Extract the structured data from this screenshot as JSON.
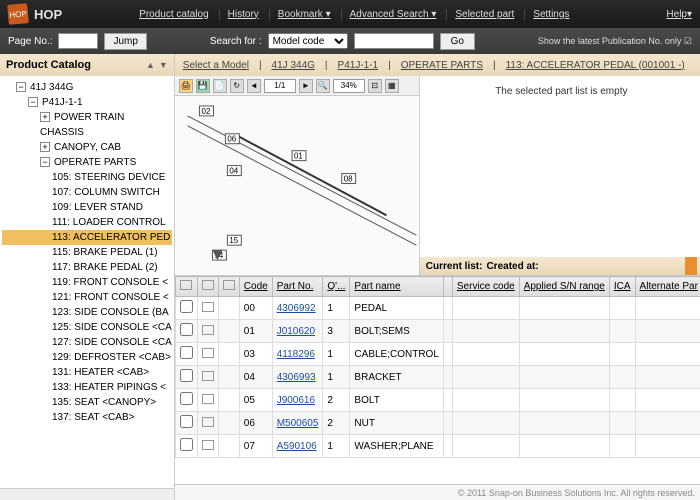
{
  "app": {
    "name": "HOP",
    "logo_text": "HOP"
  },
  "top_nav": [
    "Product catalog",
    "History",
    "Bookmark ▾",
    "Advanced Search ▾",
    "Selected part",
    "Settings"
  ],
  "help": "Help▾",
  "page_no_label": "Page No.:",
  "jump": "Jump",
  "search_for": "Search for :",
  "model_code": "Model code",
  "go": "Go",
  "pub_text": "Show the latest Publication No. only ☑",
  "sidebar_title": "Product Catalog",
  "tree": {
    "root": "41J 344G",
    "sub": "P41J-1-1",
    "groups": [
      "POWER TRAIN",
      "CHASSIS",
      "CANOPY, CAB",
      "OPERATE PARTS"
    ],
    "items": [
      "105: STEERING DEVICE",
      "107: COLUMN SWITCH",
      "109: LEVER STAND",
      "111: LOADER CONTROL",
      "113: ACCELERATOR PED",
      "115: BRAKE PEDAL (1)",
      "117: BRAKE PEDAL (2)",
      "119: FRONT CONSOLE <",
      "121: FRONT CONSOLE <",
      "123: SIDE CONSOLE (BA",
      "125: SIDE CONSOLE <CA",
      "127: SIDE CONSOLE <CA",
      "129: DEFROSTER <CAB>",
      "131: HEATER <CAB>",
      "133: HEATER PIPINGS <",
      "135: SEAT <CANOPY>",
      "137: SEAT <CAB>"
    ],
    "selected_index": 4
  },
  "breadcrumb": [
    "Select a Model",
    "41J 344G",
    "P41J-1-1",
    "OPERATE PARTS",
    "113: ACCELERATOR PEDAL (001001 -)"
  ],
  "diagram": {
    "page": "1/1",
    "zoom": "34%",
    "callouts": [
      "02",
      "06",
      "04",
      "01",
      "08",
      "15",
      "14"
    ]
  },
  "empty_msg": "The selected part list is empty",
  "current_list_label": "Current list:",
  "created_at_label": "Created at:",
  "table": {
    "headers": [
      "",
      "",
      "",
      "Code",
      "Part No.",
      "Q'...",
      "Part name",
      "",
      "Service code",
      "Applied S/N range",
      "ICA",
      "Alternate Par"
    ],
    "rows": [
      {
        "code": "00",
        "pn": "4306992",
        "qty": "1",
        "name": "PEDAL"
      },
      {
        "code": "01",
        "pn": "J010620",
        "qty": "3",
        "name": "BOLT;SEMS"
      },
      {
        "code": "03",
        "pn": "4118296",
        "qty": "1",
        "name": "CABLE;CONTROL"
      },
      {
        "code": "04",
        "pn": "4306993",
        "qty": "1",
        "name": "BRACKET"
      },
      {
        "code": "05",
        "pn": "J900616",
        "qty": "2",
        "name": "BOLT"
      },
      {
        "code": "06",
        "pn": "M500605",
        "qty": "2",
        "name": "NUT"
      },
      {
        "code": "07",
        "pn": "A590106",
        "qty": "1",
        "name": "WASHER;PLANE"
      }
    ]
  },
  "footer": "© 2011 Snap-on Business Solutions Inc. All rights reserved."
}
